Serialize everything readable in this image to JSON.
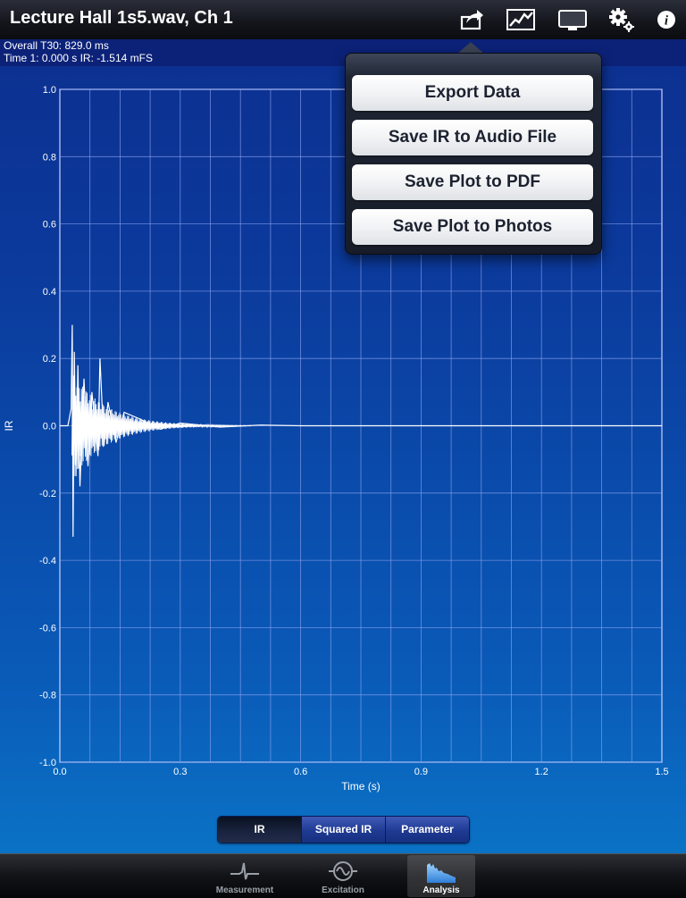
{
  "header": {
    "title": "Lecture Hall 1s5.wav, Ch 1"
  },
  "info": {
    "line1": "Overall T30:  829.0 ms",
    "line2": "Time 1: 0.000 s  IR: -1.514 mFS"
  },
  "share_menu": {
    "items": [
      "Export Data",
      "Save IR to Audio File",
      "Save Plot to PDF",
      "Save Plot to Photos"
    ]
  },
  "segmented": {
    "items": [
      "IR",
      "Squared IR",
      "Parameter"
    ],
    "selected": "IR"
  },
  "tabs": [
    {
      "label": "Measurement",
      "icon": "measurement-icon"
    },
    {
      "label": "Excitation",
      "icon": "excitation-icon"
    },
    {
      "label": "Analysis",
      "icon": "analysis-icon",
      "selected": true
    }
  ],
  "chart_data": {
    "type": "line",
    "xlabel": "Time (s)",
    "ylabel": "IR",
    "xlim": [
      0,
      1.5
    ],
    "ylim": [
      -1.0,
      1.0
    ],
    "xticks": [
      "0.0",
      "0.3",
      "0.6",
      "0.9",
      "1.2",
      "1.5"
    ],
    "yticks": [
      "1.0",
      "0.8",
      "0.6",
      "0.4",
      "0.2",
      "0.0",
      "-0.2",
      "-0.4",
      "-0.6",
      "-0.8",
      "-1.0"
    ],
    "grid": true,
    "series": [
      {
        "color": "#ffffff",
        "x": [
          0.0,
          0.02,
          0.028,
          0.031,
          0.033,
          0.036,
          0.04,
          0.045,
          0.05,
          0.06,
          0.07,
          0.08,
          0.095,
          0.1,
          0.11,
          0.12,
          0.14,
          0.16,
          0.2,
          0.25,
          0.3,
          0.4,
          0.5,
          0.6,
          0.8,
          1.0,
          1.2,
          1.5
        ],
        "y": [
          0.0,
          0.0,
          0.05,
          0.3,
          -0.33,
          0.22,
          -0.15,
          0.18,
          -0.18,
          0.14,
          -0.12,
          0.1,
          -0.09,
          0.2,
          -0.06,
          0.07,
          -0.05,
          0.04,
          0.02,
          -0.01,
          0.008,
          -0.004,
          0.002,
          0.0,
          0.0,
          0.0,
          0.0,
          0.0
        ]
      }
    ]
  }
}
